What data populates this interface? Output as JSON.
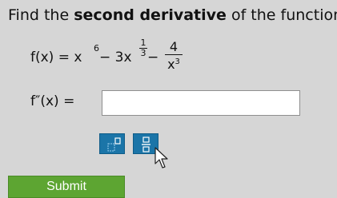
{
  "prompt": {
    "before": "Find the ",
    "bold": "second derivative",
    "after": " of the function."
  },
  "function": {
    "lhs": "f(x) = x",
    "exp1": "6",
    "minus1": " − 3x",
    "exp2_num": "1",
    "exp2_den": "3",
    "minus2": " − ",
    "frac_num": "4",
    "frac_den_base": "x",
    "frac_den_exp": "3"
  },
  "answer": {
    "label": "f″(x) = ",
    "value": ""
  },
  "toolbar": {
    "items": [
      {
        "icon": "exponent-template-icon"
      },
      {
        "icon": "fraction-template-icon"
      }
    ]
  },
  "submit": {
    "label": "Submit"
  },
  "colors": {
    "background": "#d6d6d6",
    "tool_button": "#1b75a8",
    "submit": "#5da532"
  }
}
